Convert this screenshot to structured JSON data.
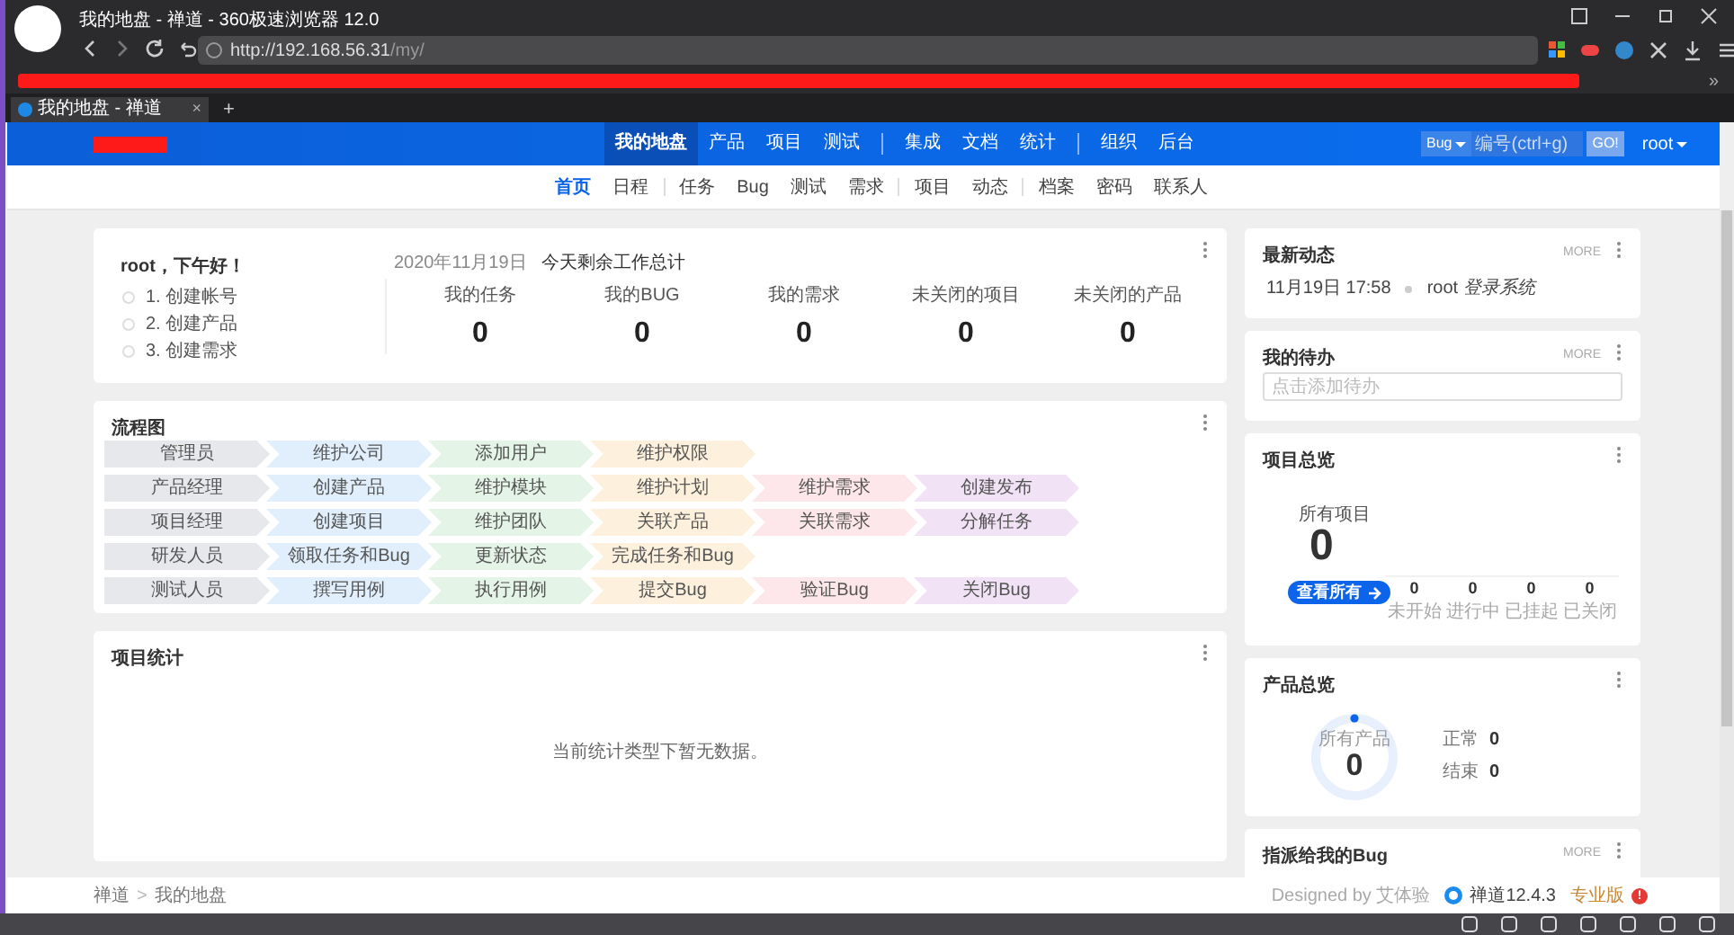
{
  "browser": {
    "title": "我的地盘 - 禅道 - 360极速浏览器 12.0",
    "url_host": "http://192.168.56.31",
    "url_path": "/my/",
    "tab": {
      "label": "我的地盘 - 禅道",
      "close": "×"
    },
    "new_tab": "+",
    "more": "»"
  },
  "header": {
    "nav": [
      {
        "label": "我的地盘",
        "selected": true
      },
      {
        "label": "产品",
        "selected": false
      },
      {
        "label": "项目",
        "selected": false
      },
      {
        "label": "测试",
        "selected": false
      },
      {
        "label": "集成",
        "selected": false,
        "divider": true
      },
      {
        "label": "文档",
        "selected": false
      },
      {
        "label": "统计",
        "selected": false
      },
      {
        "label": "组织",
        "selected": false,
        "divider": true
      },
      {
        "label": "后台",
        "selected": false
      }
    ],
    "search": {
      "type": "Bug",
      "placeholder": "编号(ctrl+g)",
      "go": "GO!"
    },
    "user": "root"
  },
  "subnav": [
    {
      "label": "首页",
      "selected": true
    },
    {
      "label": "日程",
      "selected": false
    },
    {
      "label": "任务",
      "selected": false,
      "divider": true
    },
    {
      "label": "Bug",
      "selected": false
    },
    {
      "label": "测试",
      "selected": false
    },
    {
      "label": "需求",
      "selected": false
    },
    {
      "label": "项目",
      "selected": false,
      "divider": true
    },
    {
      "label": "动态",
      "selected": false
    },
    {
      "label": "档案",
      "selected": false,
      "divider": true
    },
    {
      "label": "密码",
      "selected": false
    },
    {
      "label": "联系人",
      "selected": false
    }
  ],
  "welcome": {
    "greeting": "root，下午好！",
    "steps": [
      "1. 创建帐号",
      "2. 创建产品",
      "3. 创建需求"
    ],
    "date": "2020年11月19日",
    "subtitle": "今天剩余工作总计",
    "stats": [
      {
        "label": "我的任务",
        "value": "0"
      },
      {
        "label": "我的BUG",
        "value": "0"
      },
      {
        "label": "我的需求",
        "value": "0"
      },
      {
        "label": "未关闭的项目",
        "value": "0"
      },
      {
        "label": "未关闭的产品",
        "value": "0"
      }
    ]
  },
  "flow": {
    "title": "流程图",
    "rows": [
      [
        "管理员",
        "维护公司",
        "添加用户",
        "维护权限"
      ],
      [
        "产品经理",
        "创建产品",
        "维护模块",
        "维护计划",
        "维护需求",
        "创建发布"
      ],
      [
        "项目经理",
        "创建项目",
        "维护团队",
        "关联产品",
        "关联需求",
        "分解任务"
      ],
      [
        "研发人员",
        "领取任务和Bug",
        "更新状态",
        "完成任务和Bug"
      ],
      [
        "测试人员",
        "撰写用例",
        "执行用例",
        "提交Bug",
        "验证Bug",
        "关闭Bug"
      ]
    ]
  },
  "project_stats": {
    "title": "项目统计",
    "empty": "当前统计类型下暂无数据。"
  },
  "dynamics": {
    "title": "最新动态",
    "more": "MORE",
    "items": [
      {
        "time": "11月19日 17:58",
        "actor": "root",
        "action": "登录系统"
      }
    ]
  },
  "todo": {
    "title": "我的待办",
    "more": "MORE",
    "placeholder": "点击添加待办"
  },
  "project_overview": {
    "title": "项目总览",
    "all_label": "所有项目",
    "all_value": "0",
    "view_all": "查看所有",
    "stats": [
      {
        "label": "未开始",
        "value": "0"
      },
      {
        "label": "进行中",
        "value": "0"
      },
      {
        "label": "已挂起",
        "value": "0"
      },
      {
        "label": "已关闭",
        "value": "0"
      }
    ]
  },
  "product_overview": {
    "title": "产品总览",
    "ring_label": "所有产品",
    "ring_value": "0",
    "stats": [
      {
        "label": "正常",
        "value": "0"
      },
      {
        "label": "结束",
        "value": "0"
      }
    ]
  },
  "assigned_bugs": {
    "title": "指派给我的Bug",
    "more": "MORE"
  },
  "footer": {
    "breadcrumb": [
      "禅道",
      "我的地盘"
    ],
    "separator": ">",
    "designed_by": "Designed by 艾体验",
    "version": "禅道12.4.3",
    "edition": "专业版",
    "badge": "!"
  }
}
